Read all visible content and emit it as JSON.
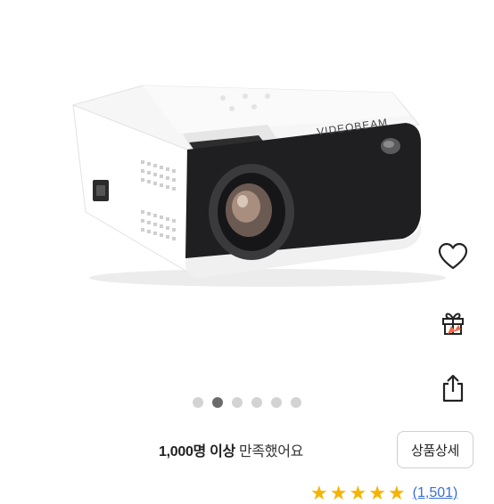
{
  "product": {
    "image_alt": "projector-image",
    "brand_mark": "VIDEOBEAM",
    "carousel": {
      "count": 6,
      "active_index": 1
    }
  },
  "actions": {
    "like": "heart-icon",
    "gift": "gift-icon",
    "share": "share-icon"
  },
  "summary": {
    "satisfied_count": "1,000명 이상",
    "satisfied_suffix": "만족했어요",
    "detail_button": "상품상세"
  },
  "rating": {
    "stars": 4.5,
    "review_count": "(1,501)"
  },
  "colors": {
    "accent_star": "#f5b400",
    "link_blue": "#3b6fd8",
    "dot_active": "#6b6b6b",
    "dot_inactive": "#d3d3d3"
  }
}
